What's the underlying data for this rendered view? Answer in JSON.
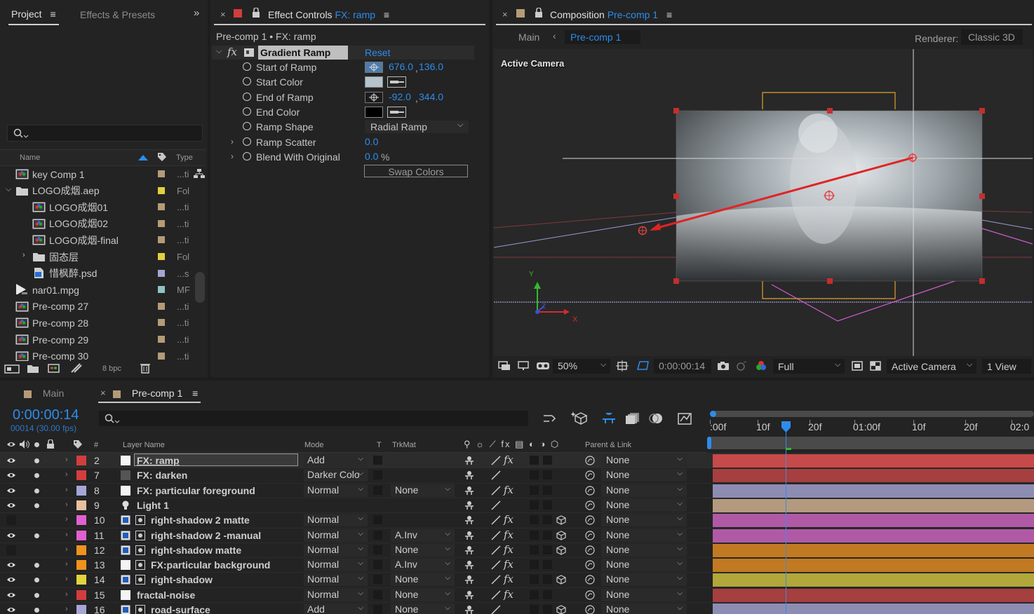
{
  "project": {
    "tabs": [
      "Project",
      "Effects & Presets"
    ],
    "search_placeholder": "",
    "col_name": "Name",
    "col_type": "Type",
    "items": [
      {
        "name": "key Comp 1",
        "type": "...ti",
        "label": "#b59b77",
        "indent": 0,
        "kind": "comp"
      },
      {
        "name": "LOGO成烟.aep",
        "type": "Fol",
        "label": "#e3cf3f",
        "indent": 0,
        "kind": "folder",
        "expanded": true
      },
      {
        "name": "LOGO成烟01",
        "type": "...ti",
        "label": "#b59b77",
        "indent": 1,
        "kind": "comp"
      },
      {
        "name": "LOGO成烟02",
        "type": "...ti",
        "label": "#b59b77",
        "indent": 1,
        "kind": "comp"
      },
      {
        "name": "LOGO成烟-final",
        "type": "...ti",
        "label": "#b59b77",
        "indent": 1,
        "kind": "comp"
      },
      {
        "name": "固态层",
        "type": "Fol",
        "label": "#e3cf3f",
        "indent": 1,
        "kind": "folder"
      },
      {
        "name": "惜枫醉.psd",
        "type": "...s",
        "label": "#a5a5d4",
        "indent": 1,
        "kind": "psd"
      },
      {
        "name": "nar01.mpg",
        "type": "MF",
        "label": "#8fc4c0",
        "indent": 0,
        "kind": "video"
      },
      {
        "name": "Pre-comp 27",
        "type": "...ti",
        "label": "#b59b77",
        "indent": 0,
        "kind": "comp"
      },
      {
        "name": "Pre-comp 28",
        "type": "...ti",
        "label": "#b59b77",
        "indent": 0,
        "kind": "comp"
      },
      {
        "name": "Pre-comp 29",
        "type": "...ti",
        "label": "#b59b77",
        "indent": 0,
        "kind": "comp"
      },
      {
        "name": "Pre-comp 30",
        "type": "...ti",
        "label": "#b59b77",
        "indent": 0,
        "kind": "comp"
      }
    ],
    "bpc": "8 bpc"
  },
  "effect_controls": {
    "tab_label": "Effect Controls",
    "tab_layer": "FX: ramp",
    "breadcrumb": "Pre-comp 1 • FX: ramp",
    "effect_name": "Gradient Ramp",
    "reset": "Reset",
    "props": [
      {
        "name": "Start of Ramp",
        "x": "676.0",
        "y": "136.0"
      },
      {
        "name": "Start Color",
        "color": "#b4c3cc"
      },
      {
        "name": "End of Ramp",
        "x": "-92.0",
        "y": "344.0"
      },
      {
        "name": "End Color",
        "color": "#000000"
      },
      {
        "name": "Ramp Shape",
        "value": "Radial Ramp"
      },
      {
        "name": "Ramp Scatter",
        "value": "0.0"
      },
      {
        "name": "Blend With Original",
        "value": "0.0",
        "unit": "%"
      }
    ],
    "swap": "Swap Colors"
  },
  "composition": {
    "tab_label": "Composition",
    "tab_comp": "Pre-comp 1",
    "crumbs": [
      "Main",
      "Pre-comp 1"
    ],
    "renderer_label": "Renderer:",
    "renderer": "Classic 3D",
    "view_label": "Active Camera",
    "axis": {
      "x": "X",
      "y": "Y",
      "z": "Z"
    },
    "zoom": "50%",
    "timecode": "0:00:00:14",
    "resolution": "Full",
    "camera": "Active Camera",
    "views": "1 View"
  },
  "timeline": {
    "tabs": [
      "Main",
      "Pre-comp 1"
    ],
    "timecode": "0:00:00:14",
    "frames": "00014 (30.00 fps)",
    "search_placeholder": "",
    "col_num": "#",
    "col_name": "Layer Name",
    "col_mode": "Mode",
    "col_t": "T",
    "col_trkmat": "TrkMat",
    "col_parent": "Parent & Link",
    "ruler": [
      ":00f",
      "10f",
      "20f",
      "01:00f",
      "10f",
      "20f",
      "02:0"
    ],
    "layers": [
      {
        "num": "2",
        "name": "FX: ramp",
        "mode": "Add",
        "trkmat": "",
        "parent": "None",
        "label": "#d23d3d",
        "bar": "#c64a4a",
        "eye": true,
        "icon": "solid",
        "fx": true,
        "selected": true
      },
      {
        "num": "7",
        "name": "FX: darken",
        "mode": "Darker Colo",
        "trkmat": "",
        "parent": "None",
        "label": "#d23d3d",
        "bar": "#a63f3f",
        "eye": true,
        "icon": "solid-dark",
        "fx": false
      },
      {
        "num": "8",
        "name": "FX: particular foreground",
        "mode": "Normal",
        "trkmat": "None",
        "parent": "None",
        "label": "#a6a6d6",
        "bar": "#8d8db4",
        "eye": true,
        "icon": "solid",
        "fx": true
      },
      {
        "num": "9",
        "name": "Light 1",
        "mode": "",
        "trkmat": "",
        "parent": "None",
        "label": "#e6c0a0",
        "bar": "#b39a7e",
        "eye": true,
        "icon": "light",
        "fx": false
      },
      {
        "num": "10",
        "name": "right-shadow 2 matte",
        "mode": "Normal",
        "trkmat": "",
        "parent": "None",
        "label": "#e060d0",
        "bar": "#b05aa6",
        "eye": false,
        "icon": "comp",
        "fx": true
      },
      {
        "num": "11",
        "name": "right-shadow 2 -manual",
        "mode": "Normal",
        "trkmat": "A.Inv",
        "parent": "None",
        "label": "#e060d0",
        "bar": "#b05aa6",
        "eye": true,
        "icon": "comp",
        "fx": true
      },
      {
        "num": "12",
        "name": "right-shadow matte",
        "mode": "Normal",
        "trkmat": "None",
        "parent": "None",
        "label": "#f0921e",
        "bar": "#c17a22",
        "eye": false,
        "icon": "comp",
        "fx": true
      },
      {
        "num": "13",
        "name": "FX:particular background",
        "mode": "Normal",
        "trkmat": "A.Inv",
        "parent": "None",
        "label": "#f0921e",
        "bar": "#c17a22",
        "eye": true,
        "icon": "solid",
        "fx": true
      },
      {
        "num": "14",
        "name": "right-shadow",
        "mode": "Normal",
        "trkmat": "None",
        "parent": "None",
        "label": "#e3d33c",
        "bar": "#b1a73b",
        "eye": true,
        "icon": "comp",
        "fx": true
      },
      {
        "num": "15",
        "name": "fractal-noise",
        "mode": "Normal",
        "trkmat": "None",
        "parent": "None",
        "label": "#d23d3d",
        "bar": "#a63f3f",
        "eye": true,
        "icon": "solid",
        "fx": true
      },
      {
        "num": "16",
        "name": "road-surface",
        "mode": "Add",
        "trkmat": "None",
        "parent": "None",
        "label": "#a6a6d6",
        "bar": "#8d8db4",
        "eye": true,
        "icon": "comp",
        "fx": false
      }
    ]
  },
  "colors": {
    "accent": "#2d8ceb",
    "panel": "#232323",
    "bg": "#1d1d1d"
  }
}
